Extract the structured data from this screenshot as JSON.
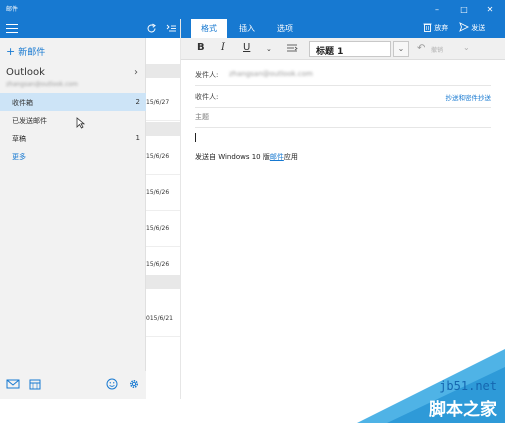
{
  "window": {
    "title": "邮件",
    "min_glyph": "–",
    "max_glyph": "□",
    "close_glyph": "✕"
  },
  "colors": {
    "accent": "#1779d1",
    "selected": "#cde4f7",
    "sidebar_bg": "#f2f2f2"
  },
  "sidebar": {
    "new_mail": "新邮件",
    "account": {
      "name": "Outlook",
      "email": "zhangsan@outlook.com"
    },
    "folders": [
      {
        "label": "收件箱",
        "count": "2"
      },
      {
        "label": "已发送邮件",
        "count": ""
      },
      {
        "label": "草稿",
        "count": "1"
      },
      {
        "label": "更多",
        "count": ""
      }
    ],
    "bottom_icons": [
      "mail-icon",
      "calendar-icon",
      "smiley-icon",
      "settings-icon"
    ]
  },
  "message_list": {
    "dates": [
      "15/6/27",
      "15/6/26",
      "15/6/26",
      "15/6/26",
      "15/6/26",
      "015/6/21"
    ]
  },
  "compose": {
    "tabs": [
      "格式",
      "插入",
      "选项"
    ],
    "discard_label": "放弃",
    "send_label": "发送",
    "format": {
      "bold": "B",
      "italic": "I",
      "underline": "U",
      "style_value": "标题 1",
      "undo_label": "撤销"
    },
    "fields": {
      "from_label": "发件人:",
      "from_value": "zhangsan@outlook.com",
      "to_label": "收件人:",
      "cc_bcc_link": "抄送和密件抄送",
      "subject_placeholder": "主题"
    },
    "signature": {
      "prefix": "发送自 Windows 10 版",
      "link": "邮件",
      "suffix": "应用"
    }
  },
  "watermark": {
    "site": "jb51.net",
    "name": "脚本之家"
  }
}
